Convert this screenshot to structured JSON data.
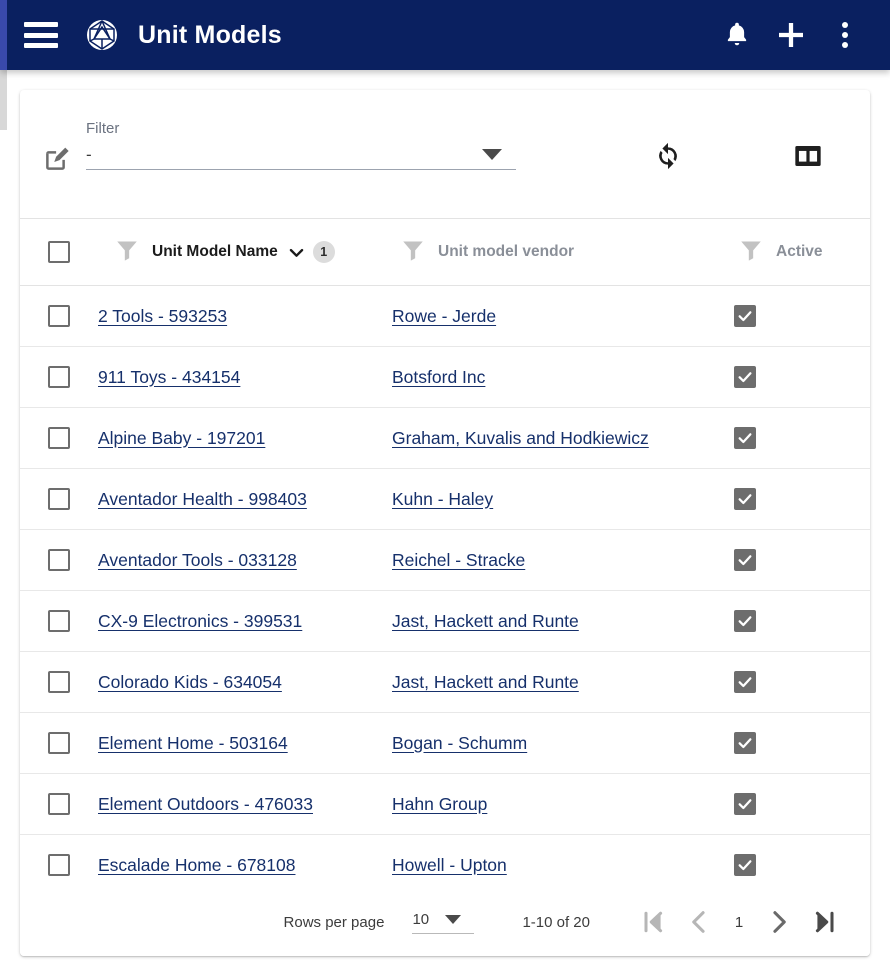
{
  "appbar": {
    "menu_icon": "hamburger-menu-icon",
    "logo_icon": "polyhedron-logo-icon",
    "title": "Unit Models",
    "notifications_icon": "bell-icon",
    "add_icon": "plus-icon",
    "more_icon": "vertical-dots-icon",
    "background_color": "#0a2060",
    "accent_color": "#3949ab"
  },
  "filter_bar": {
    "edit_icon": "edit-square-icon",
    "label": "Filter",
    "value": "-",
    "dropdown_icon": "chevron-down-icon",
    "refresh_icon": "refresh-sync-icon",
    "columns_icon": "view-columns-icon"
  },
  "table": {
    "select_all_checkbox": false,
    "columns": [
      {
        "key": "name",
        "label": "Unit Model Name",
        "sorted": true,
        "sort_direction": "desc",
        "sort_badge": "1",
        "filter_icon": "funnel-filter-icon"
      },
      {
        "key": "vendor",
        "label": "Unit model vendor",
        "sorted": false,
        "sort_direction": "",
        "sort_badge": "",
        "filter_icon": "funnel-filter-icon"
      },
      {
        "key": "active",
        "label": "Active",
        "sorted": false,
        "sort_direction": "",
        "sort_badge": "",
        "filter_icon": "funnel-filter-icon"
      }
    ],
    "rows": [
      {
        "selected": false,
        "name": "2 Tools - 593253",
        "vendor": "Rowe - Jerde",
        "active": true
      },
      {
        "selected": false,
        "name": "911 Toys - 434154",
        "vendor": "Botsford Inc",
        "active": true
      },
      {
        "selected": false,
        "name": "Alpine Baby - 197201",
        "vendor": "Graham, Kuvalis and Hodkiewicz",
        "active": true
      },
      {
        "selected": false,
        "name": "Aventador Health - 998403",
        "vendor": "Kuhn - Haley",
        "active": true
      },
      {
        "selected": false,
        "name": "Aventador Tools - 033128",
        "vendor": "Reichel - Stracke",
        "active": true
      },
      {
        "selected": false,
        "name": "CX-9 Electronics - 399531",
        "vendor": "Jast, Hackett and Runte",
        "active": true
      },
      {
        "selected": false,
        "name": "Colorado Kids - 634054",
        "vendor": "Jast, Hackett and Runte",
        "active": true
      },
      {
        "selected": false,
        "name": "Element Home - 503164",
        "vendor": "Bogan - Schumm",
        "active": true
      },
      {
        "selected": false,
        "name": "Element Outdoors - 476033",
        "vendor": "Hahn Group",
        "active": true
      },
      {
        "selected": false,
        "name": "Escalade Home - 678108",
        "vendor": "Howell - Upton",
        "active": true
      }
    ]
  },
  "paginator": {
    "rows_per_page_label": "Rows per page",
    "rows_per_page_value": "10",
    "range_label": "1-10 of 20",
    "page_number": "1",
    "first_page_icon": "first-page-icon",
    "prev_page_icon": "chevron-left-icon",
    "next_page_icon": "chevron-right-icon",
    "last_page_icon": "last-page-icon",
    "first_enabled": false,
    "prev_enabled": false,
    "next_enabled": true,
    "last_enabled": true
  },
  "colors": {
    "link": "#16306b",
    "header_text_muted": "#8a8f98",
    "checkbox_checked": "#6d6d6d"
  }
}
